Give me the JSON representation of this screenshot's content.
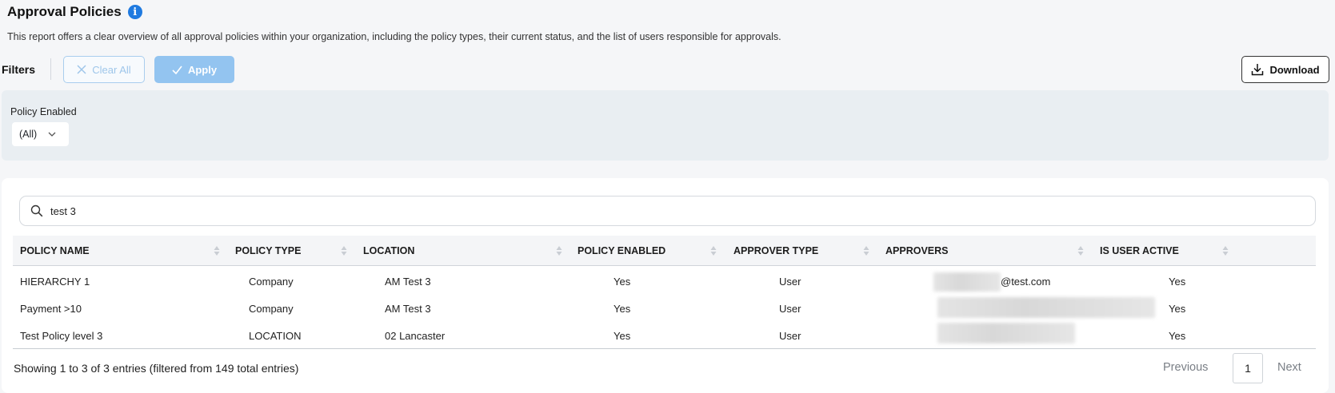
{
  "header": {
    "title": "Approval Policies",
    "info_icon": "i",
    "description": "This report offers a clear overview of all approval policies within your organization, including the policy types, their current status, and the list of users responsible for approvals."
  },
  "filters": {
    "label": "Filters",
    "clear_all_label": "Clear All",
    "apply_label": "Apply",
    "download_label": "Download",
    "policy_enabled": {
      "label": "Policy Enabled",
      "selected": "(All)"
    }
  },
  "search": {
    "value": "test 3"
  },
  "table": {
    "columns": [
      "POLICY NAME",
      "POLICY TYPE",
      "LOCATION",
      "POLICY ENABLED",
      "APPROVER TYPE",
      "APPROVERS",
      "IS USER ACTIVE"
    ],
    "rows": [
      {
        "policy_name": "HIERARCHY 1",
        "policy_type": "Company",
        "location": "AM Test 3",
        "policy_enabled": "Yes",
        "approver_type": "User",
        "approvers": "@test.com",
        "is_user_active": "Yes"
      },
      {
        "policy_name": "Payment >10",
        "policy_type": "Company",
        "location": "AM Test 3",
        "policy_enabled": "Yes",
        "approver_type": "User",
        "approvers": "",
        "is_user_active": "Yes"
      },
      {
        "policy_name": "Test Policy level 3",
        "policy_type": "LOCATION",
        "location": "02 Lancaster",
        "policy_enabled": "Yes",
        "approver_type": "User",
        "approvers": "",
        "is_user_active": "Yes"
      }
    ]
  },
  "pagination": {
    "summary": "Showing 1 to 3 of 3 entries (filtered from 149 total entries)",
    "previous_label": "Previous",
    "current_page": "1",
    "next_label": "Next"
  },
  "colors": {
    "accent": "#1f7ae0",
    "apply_button": "#93c4f0",
    "filter_panel": "#e9eef2"
  }
}
